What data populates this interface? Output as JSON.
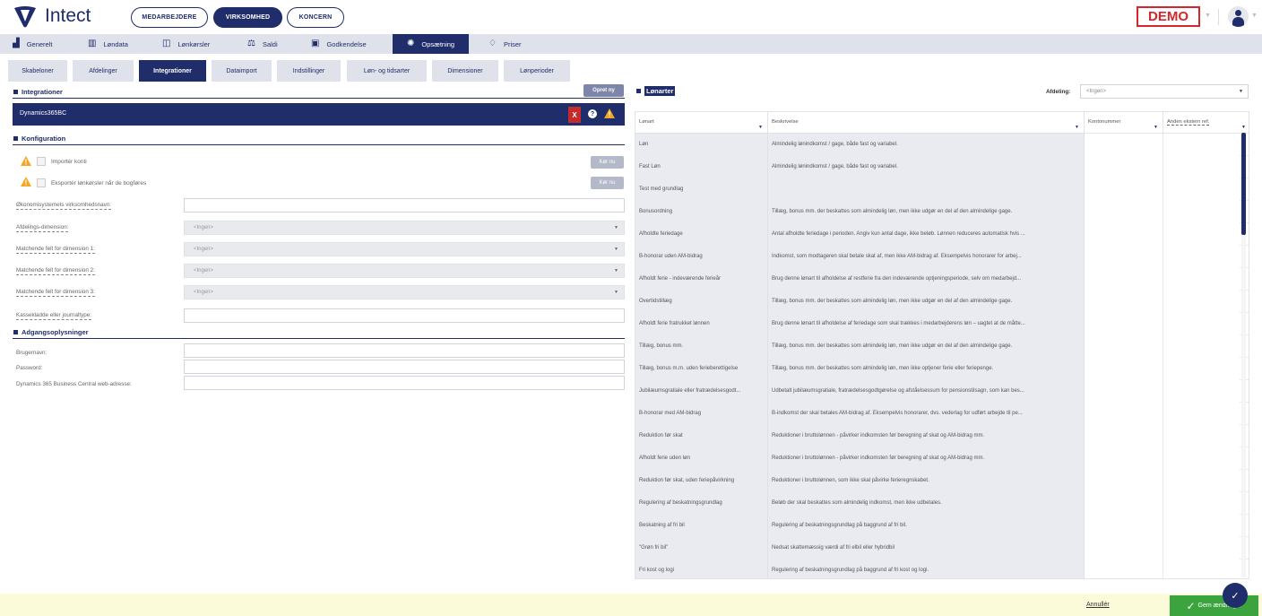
{
  "app": {
    "brand": "Intect",
    "context_pills": [
      "MEDARBEJDERE",
      "VIRKSOMHED",
      "KONCERN"
    ],
    "demo_badge": "DEMO"
  },
  "main_nav": [
    {
      "label": "Generelt",
      "icon": "bar-chart-icon"
    },
    {
      "label": "Løndata",
      "icon": "table-icon"
    },
    {
      "label": "Lønkørsler",
      "icon": "payroll-run-icon"
    },
    {
      "label": "Saldi",
      "icon": "scale-icon"
    },
    {
      "label": "Godkendelse",
      "icon": "calendar-check-icon"
    },
    {
      "label": "Opsætning",
      "icon": "gear-icon"
    },
    {
      "label": "Priser",
      "icon": "diamond-icon"
    }
  ],
  "sub_tabs": [
    "Skabeloner",
    "Afdelinger",
    "Integrationer",
    "Dataimport",
    "Indstillinger",
    "Løn- og tidsarter",
    "Dimensioner",
    "Lønperioder"
  ],
  "integrations": {
    "title": "Integrationer",
    "create_button": "Opret ny",
    "selected_name": "Dynamics365BC",
    "delete_label": "X"
  },
  "configuration": {
    "title": "Konfiguration",
    "checkboxes": [
      {
        "label": "Importér konti",
        "run_label": "Kør nu"
      },
      {
        "label": "Eksportér lønkørsler når de bogføres",
        "run_label": "Kør nu"
      }
    ],
    "fields": [
      {
        "label": "Økonomisystemets virksomhedsnavn:",
        "type": "input",
        "value": ""
      },
      {
        "label": "Afdelings-dimension:",
        "type": "select",
        "value": "<Ingen>"
      },
      {
        "label": "Matchende felt for dimension 1:",
        "type": "select",
        "value": "<Ingen>"
      },
      {
        "label": "Matchende felt for dimension 2:",
        "type": "select",
        "value": "<Ingen>"
      },
      {
        "label": "Matchende felt for dimension 3:",
        "type": "select",
        "value": "<Ingen>"
      },
      {
        "label": "Kassekladde eller journaltype:",
        "type": "input",
        "value": ""
      }
    ]
  },
  "access": {
    "title": "Adgangsoplysninger",
    "fields": [
      {
        "label": "Brugernavn:",
        "value": ""
      },
      {
        "label": "Password:",
        "value": ""
      },
      {
        "label": "Dynamics 365 Business Central web-adresse:",
        "value": ""
      }
    ]
  },
  "wage_types": {
    "title": "Lønarter",
    "department_label": "Afdeling:",
    "department_value": "<Ingen>",
    "columns": [
      "Lønart",
      "Beskrivelse",
      "Kontonummer",
      "Anden ekstern ref."
    ],
    "rows": [
      [
        "Løn",
        "Almindelig lønindkomst / gage, både fast og variabel."
      ],
      [
        "Fast Løn",
        "Almindelig lønindkomst / gage, både fast og variabel."
      ],
      [
        "Test med grundlag",
        ""
      ],
      [
        "Bonusordning",
        "Tillæg, bonus mm. der beskattes som almindelig løn, men ikke udgør en del af den almindelige gage."
      ],
      [
        "Afholdte feriedage",
        "Antal afholdte feriedage i perioden. Angiv kun antal dage, ikke beløb. Lønnen reduceres automatisk hvis ..."
      ],
      [
        "B-honorar uden AM-bidrag",
        "Indkomst, som modtageren skal betale skat af, men ikke AM-bidrag af. Eksempelvis honorarer for arbej..."
      ],
      [
        "Afholdt ferie - indeværende ferieår",
        "Brug denne lønart til afholdelse af restferie fra den indeværende optjeningsperiode, selv om medarbejd..."
      ],
      [
        "Overtidstillæg",
        "Tillæg, bonus mm. der beskattes som almindelig løn, men ikke udgør en del af den almindelige gage."
      ],
      [
        "Afholdt ferie fratrukket lønnen",
        "Brug denne lønart til afholdelse af feriedage som skal trækkes i medarbejderens løn – uagtet at de måtte..."
      ],
      [
        "Tillæg, bonus mm.",
        "Tillæg, bonus mm. der beskattes som almindelig løn, men ikke udgør en del af den almindelige gage."
      ],
      [
        "Tillæg, bonus m.m. uden ferieberettigelse",
        "Tillæg, bonus mm. der beskattes som almindelig løn, men ikke optjener ferie eller feriepenge."
      ],
      [
        "Jubilæumsgratiale eller fratrædelsesgodt...",
        "Udbetalt jubilæumsgratiale, fratrædelsesgodtgørelse og afståelsessum for pensionstilsagn, som kan bes..."
      ],
      [
        "B-honorar med AM-bidrag",
        "B-indkomst der skal betales AM-bidrag af. Eksempelvis honorarer, dvs. vederlag for udført arbejde til pe..."
      ],
      [
        "Reduktion før skat",
        "Reduktioner i bruttolønnen - påvirker indkomsten før beregning af skat og AM-bidrag mm."
      ],
      [
        "Afholdt ferie uden løn",
        "Reduktioner i bruttolønnen - påvirker indkomsten før beregning af skat og AM-bidrag mm."
      ],
      [
        "Reduktion før skat, uden feriepåvirkning",
        "Reduktioner i bruttolønnen, som ikke skal påvirke ferieregnskabet."
      ],
      [
        "Regulering af beskatningsgrundlag",
        "Beløb der skal beskattes som almindelig indkomst, men ikke udbetales."
      ],
      [
        "Beskatning af fri bil",
        "Regulering af beskatningsgrundlag på baggrund af fri bil."
      ],
      [
        "\"Grøn fri bil\"",
        "Nedsat skattemæssig værdi af fri elbil eller hybridbil"
      ],
      [
        "Fri kost og logi",
        "Regulering af beskatningsgrundlag på baggrund af fri kost og logi."
      ]
    ]
  },
  "footer": {
    "cancel_label": "Annullér",
    "save_label": "Gem ændringer"
  },
  "colors": {
    "brand": "#1f2d6b",
    "demo": "#d6252b",
    "save": "#3ca43f",
    "warning": "#f5a623",
    "footer_bg": "#fbfbd9"
  }
}
